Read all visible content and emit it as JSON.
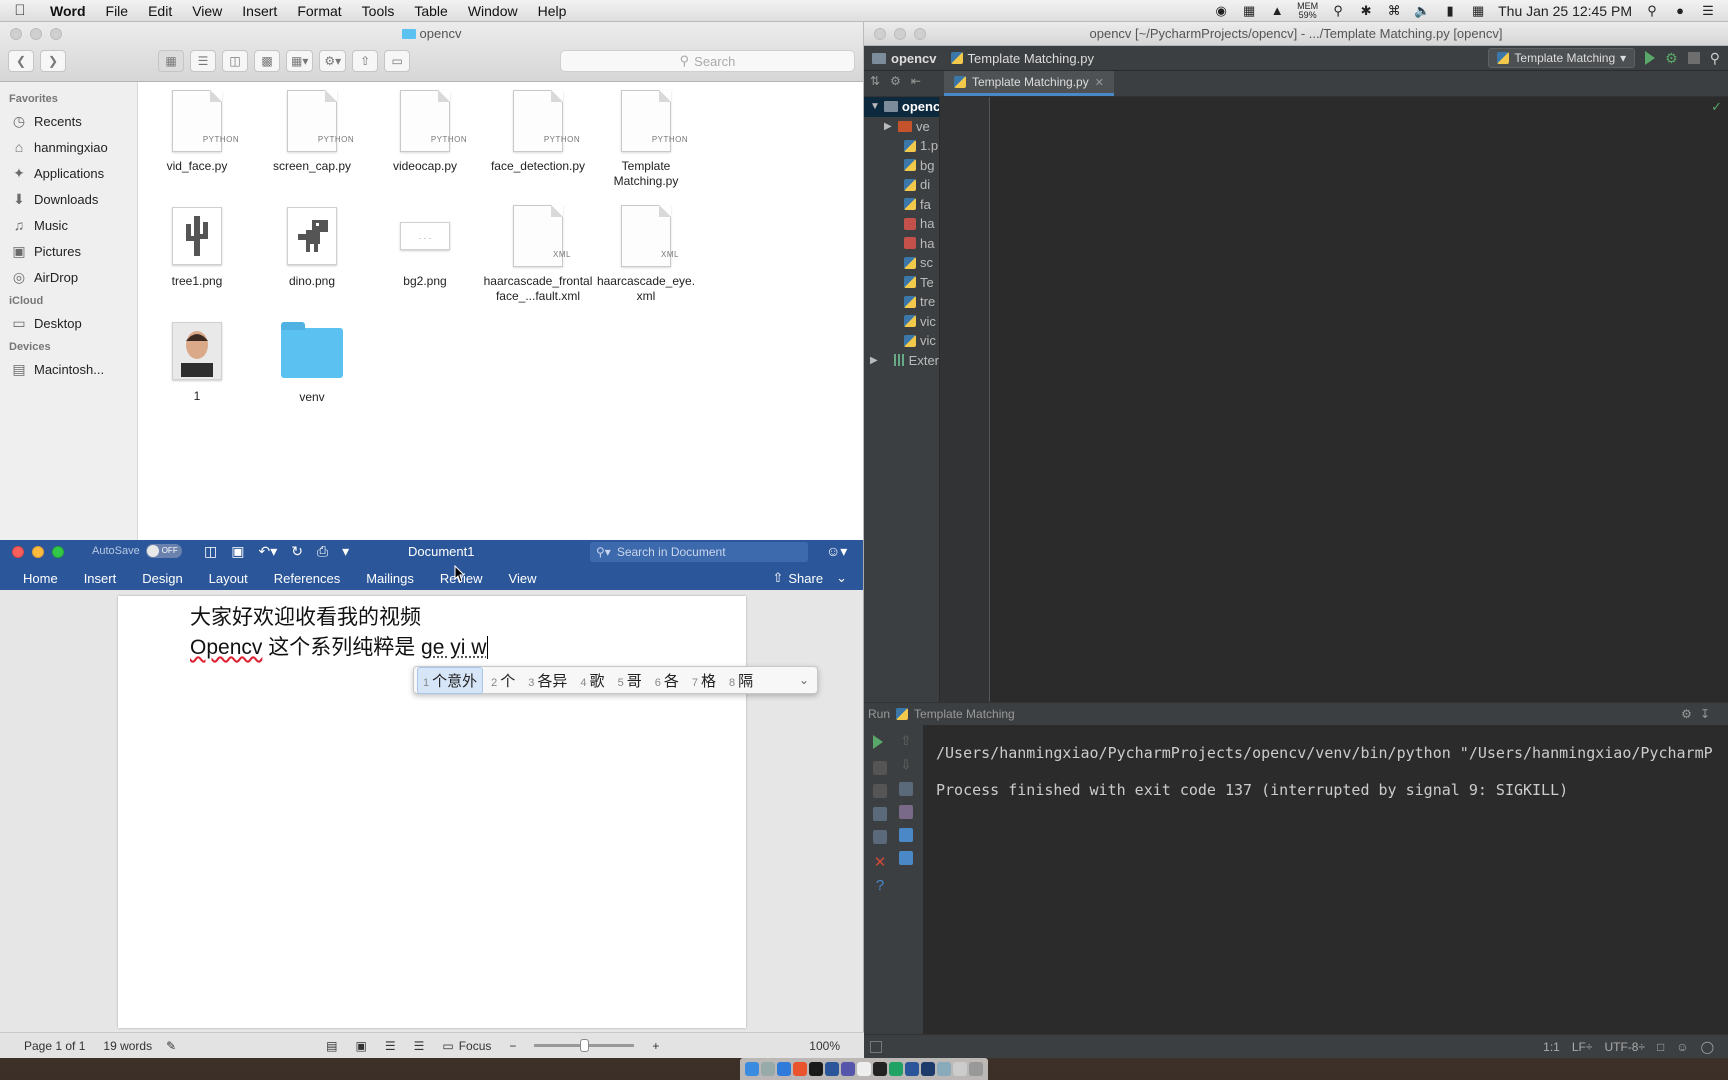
{
  "menubar": {
    "app_name": "Word",
    "menus": [
      "File",
      "Edit",
      "View",
      "Insert",
      "Format",
      "Tools",
      "Table",
      "Window",
      "Help"
    ],
    "mem_label": "MEM",
    "mem_value": "59%",
    "datetime": "Thu Jan 25  12:45 PM"
  },
  "finder": {
    "title": "opencv",
    "search_placeholder": "Search",
    "sidebar": {
      "favorites_header": "Favorites",
      "favorites": [
        {
          "label": "Recents",
          "icon": "clock-icon"
        },
        {
          "label": "hanmingxiao",
          "icon": "home-icon"
        },
        {
          "label": "Applications",
          "icon": "applications-icon"
        },
        {
          "label": "Downloads",
          "icon": "download-icon"
        },
        {
          "label": "Music",
          "icon": "music-icon"
        },
        {
          "label": "Pictures",
          "icon": "camera-icon"
        },
        {
          "label": "AirDrop",
          "icon": "airdrop-icon"
        }
      ],
      "icloud_header": "iCloud",
      "icloud": [
        {
          "label": "Desktop",
          "icon": "desktop-icon"
        }
      ],
      "devices_header": "Devices",
      "devices": [
        {
          "label": "Macintosh...",
          "icon": "disk-icon"
        }
      ]
    },
    "files": [
      {
        "name": "vid_face.py",
        "kind": "PYTHON"
      },
      {
        "name": "screen_cap.py",
        "kind": "PYTHON"
      },
      {
        "name": "videocap.py",
        "kind": "PYTHON"
      },
      {
        "name": "face_detection.py",
        "kind": "PYTHON"
      },
      {
        "name": "Template Matching.py",
        "kind": "PYTHON"
      },
      {
        "name": "tree1.png",
        "kind": "image"
      },
      {
        "name": "dino.png",
        "kind": "image"
      },
      {
        "name": "bg2.png",
        "kind": "image"
      },
      {
        "name": "haarcascade_frontalface_...fault.xml",
        "kind": "XML"
      },
      {
        "name": "haarcascade_eye.xml",
        "kind": "XML"
      },
      {
        "name": "1",
        "kind": "image"
      },
      {
        "name": "venv",
        "kind": "folder"
      }
    ]
  },
  "pycharm": {
    "title": "opencv [~/PycharmProjects/opencv] - .../Template Matching.py [opencv]",
    "nav_project": "opencv",
    "nav_file": "Template Matching.py",
    "run_config": "Template Matching",
    "tab_label": "Template Matching.py",
    "tree": [
      {
        "label": "openc",
        "type": "root"
      },
      {
        "label": "ve",
        "type": "folder"
      },
      {
        "label": "1.p",
        "type": "py"
      },
      {
        "label": "bg",
        "type": "py"
      },
      {
        "label": "di",
        "type": "py"
      },
      {
        "label": "fa",
        "type": "py"
      },
      {
        "label": "ha",
        "type": "xml"
      },
      {
        "label": "ha",
        "type": "xml"
      },
      {
        "label": "sc",
        "type": "py"
      },
      {
        "label": "Te",
        "type": "py"
      },
      {
        "label": "tre",
        "type": "py"
      },
      {
        "label": "vic",
        "type": "py"
      },
      {
        "label": "vic",
        "type": "py"
      },
      {
        "label": "Exter",
        "type": "lib"
      }
    ],
    "run_label": "Run",
    "run_config_panel": "Template Matching",
    "output_line1": "/Users/hanmingxiao/PycharmProjects/opencv/venv/bin/python \"/Users/hanmingxiao/PycharmP",
    "output_line2": "Process finished with exit code 137 (interrupted by signal 9: SIGKILL)",
    "status": {
      "position": "1:1",
      "line_sep": "LF÷",
      "encoding": "UTF-8÷"
    }
  },
  "word": {
    "autosave_label": "AutoSave",
    "autosave_state": "OFF",
    "doc_title": "Document1",
    "search_placeholder": "Search in Document",
    "tabs": [
      "Home",
      "Insert",
      "Design",
      "Layout",
      "References",
      "Mailings",
      "Review",
      "View"
    ],
    "share_label": "Share",
    "line1": "大家好欢迎收看我的视频",
    "line2_word": "Opencv",
    "line2_rest": " 这个系列纯粹是 ",
    "line2_pinyin": "ge yi w",
    "candidates": [
      {
        "n": "1",
        "text": "个意外"
      },
      {
        "n": "2",
        "text": "个"
      },
      {
        "n": "3",
        "text": "各异"
      },
      {
        "n": "4",
        "text": "歌"
      },
      {
        "n": "5",
        "text": "哥"
      },
      {
        "n": "6",
        "text": "各"
      },
      {
        "n": "7",
        "text": "格"
      },
      {
        "n": "8",
        "text": "隔"
      }
    ],
    "status": {
      "page": "Page 1 of 1",
      "words": "19 words",
      "focus": "Focus",
      "zoom": "100%"
    }
  },
  "colors": {
    "word_blue": "#2b579a",
    "pycharm_bg": "#2b2b2b",
    "finder_folder": "#5bc1f0"
  }
}
